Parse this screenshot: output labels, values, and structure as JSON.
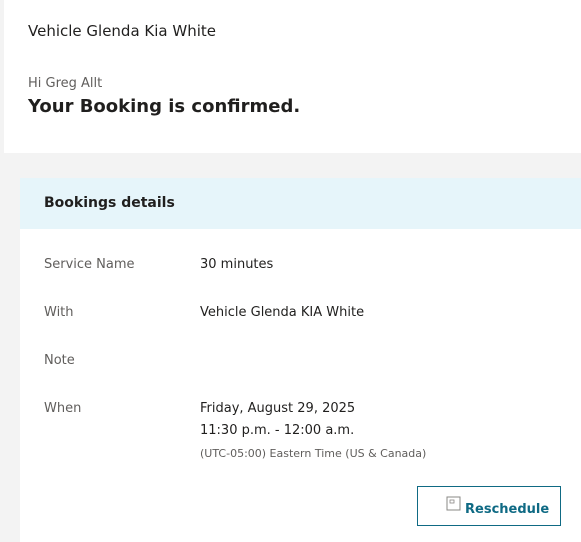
{
  "header": {
    "vehicle_title": "Vehicle Glenda Kia White",
    "greeting": "Hi Greg Allt",
    "confirmation": "Your Booking is confirmed."
  },
  "details": {
    "title": "Bookings details",
    "rows": [
      {
        "label": "Service Name",
        "value": "30 minutes"
      },
      {
        "label": "With",
        "value": "Vehicle Glenda KIA White"
      },
      {
        "label": "Note",
        "value": ""
      },
      {
        "label": "When",
        "date": "Friday, August 29, 2025",
        "time": "11:30 p.m. - 12:00 a.m.",
        "timezone": "(UTC-05:00) Eastern Time (US & Canada)"
      }
    ]
  },
  "actions": {
    "reschedule_label": "Reschedule",
    "reschedule_icon": "calendar-icon"
  },
  "colors": {
    "accent": "#0f6a84",
    "header_band": "#e6f5fa",
    "page_bg": "#f3f3f3"
  }
}
